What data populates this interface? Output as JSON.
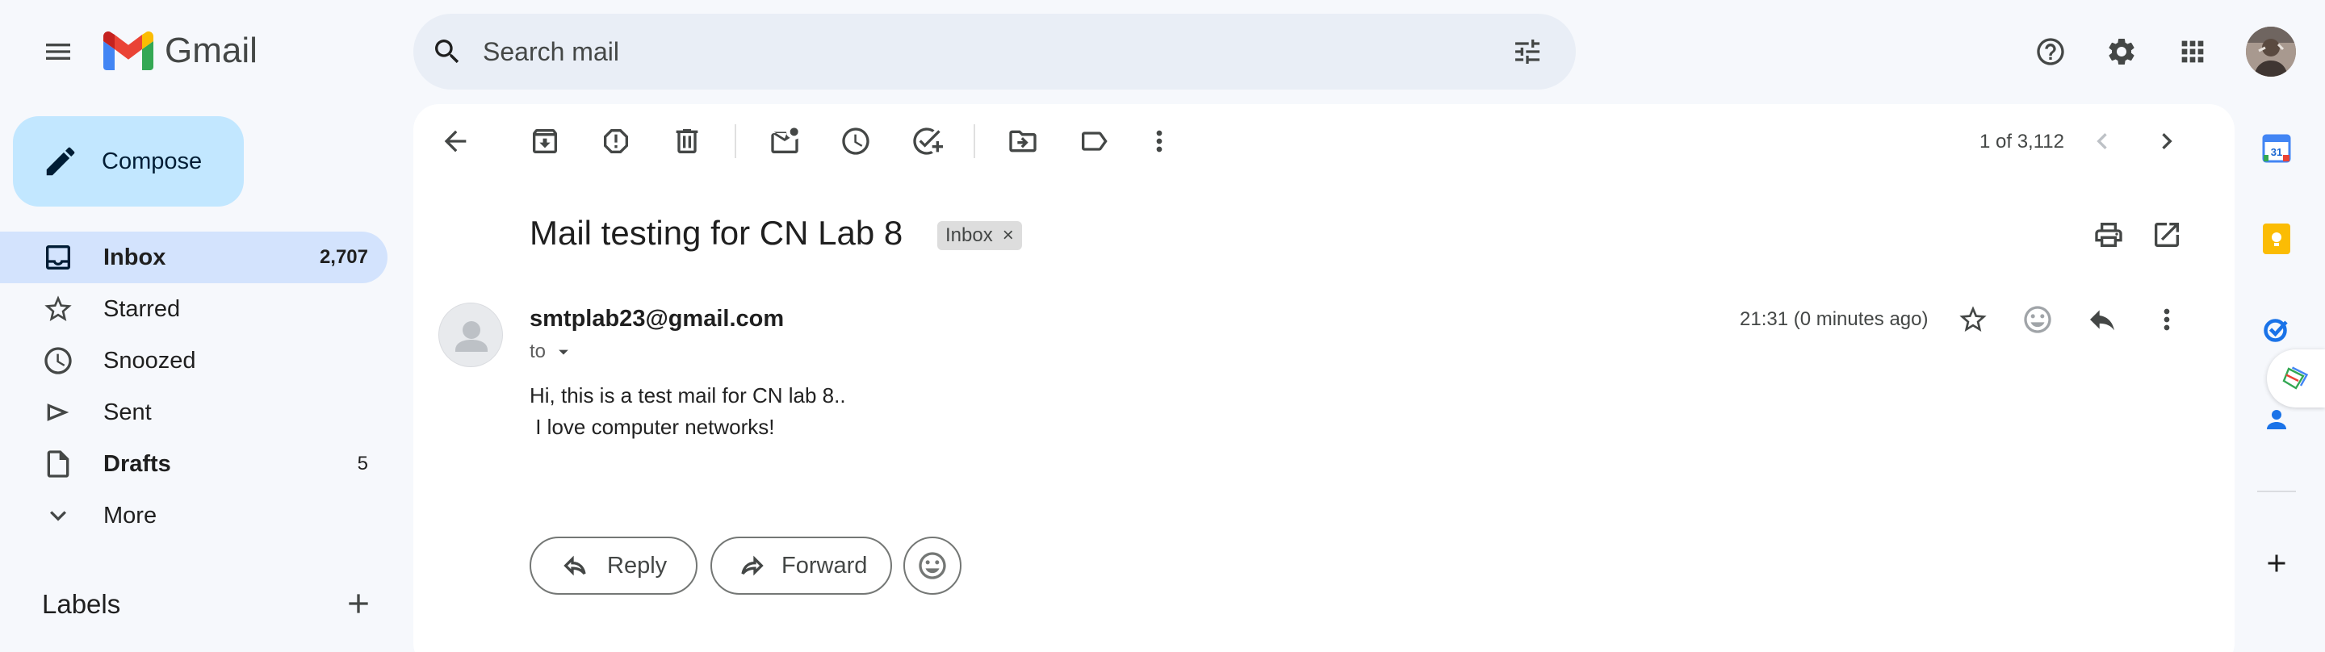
{
  "app": {
    "name": "Gmail"
  },
  "search": {
    "placeholder": "Search mail"
  },
  "compose": {
    "label": "Compose"
  },
  "sidebar": {
    "items": [
      {
        "label": "Inbox",
        "count": "2,707"
      },
      {
        "label": "Starred",
        "count": ""
      },
      {
        "label": "Snoozed",
        "count": ""
      },
      {
        "label": "Sent",
        "count": ""
      },
      {
        "label": "Drafts",
        "count": "5"
      },
      {
        "label": "More",
        "count": ""
      }
    ],
    "labels_heading": "Labels"
  },
  "toolbar": {
    "pagination": "1 of 3,112"
  },
  "message": {
    "subject": "Mail testing for CN Lab 8",
    "label_chip": "Inbox",
    "chip_close": "×",
    "sender": "smtplab23@gmail.com",
    "to": "to",
    "time": "21:31 (0 minutes ago)",
    "body": [
      "Hi, this is a test mail for CN lab 8..",
      " I love computer networks!"
    ]
  },
  "actions": {
    "reply": "Reply",
    "forward": "Forward"
  },
  "rail": {
    "calendar_day": "31"
  },
  "colors": {
    "page_bg": "#f6f8fc",
    "compose_bg": "#c2e7ff",
    "active_nav_bg": "#d3e3fd",
    "search_bg": "#e9eef6"
  }
}
